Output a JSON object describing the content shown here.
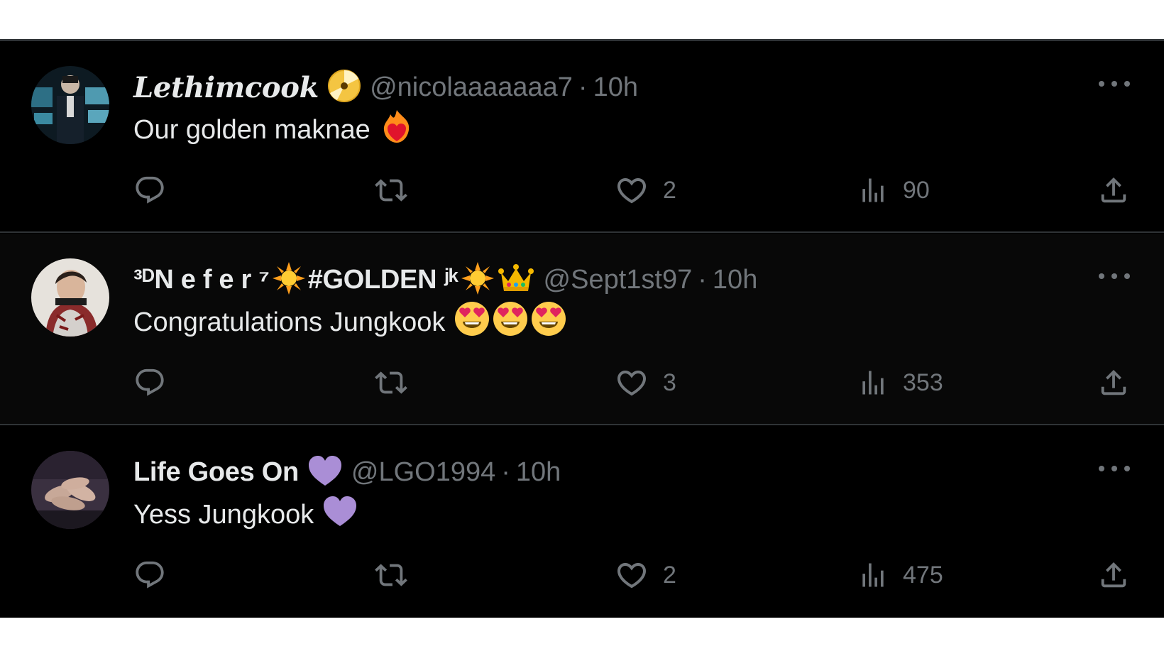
{
  "colors": {
    "background": "#000000",
    "text": "#e7e9ea",
    "muted": "#71767b",
    "divider": "#2f3336"
  },
  "tweets": [
    {
      "display_name": "Lethimcook",
      "name_badge_icon": "golden-disc-icon",
      "handle": "@nicolaaaaaaa7",
      "separator": "·",
      "time": "10h",
      "text": "Our golden maknae",
      "text_emoji_icon": "heart-on-fire-icon",
      "reply_count": "",
      "retweet_count": "",
      "like_count": "2",
      "view_count": "90"
    },
    {
      "display_name_prefix": "³ᴰN e f e r ⁷",
      "display_name_mid": "#GOLDEN ʲᵏ",
      "name_icons": [
        "sun-icon",
        "sun-icon",
        "crown-icon"
      ],
      "handle": "@Sept1st97",
      "separator": "·",
      "time": "10h",
      "text": "Congratulations Jungkook",
      "text_emoji_icons": [
        "heart-eyes-icon",
        "heart-eyes-icon",
        "heart-eyes-icon"
      ],
      "reply_count": "",
      "retweet_count": "",
      "like_count": "3",
      "view_count": "353"
    },
    {
      "display_name": "Life Goes On",
      "name_badge_icon": "purple-heart-icon",
      "handle": "@LGO1994",
      "separator": "·",
      "time": "10h",
      "text": "Yess Jungkook",
      "text_emoji_icon": "purple-heart-icon",
      "reply_count": "",
      "retweet_count": "",
      "like_count": "2",
      "view_count": "475"
    }
  ]
}
